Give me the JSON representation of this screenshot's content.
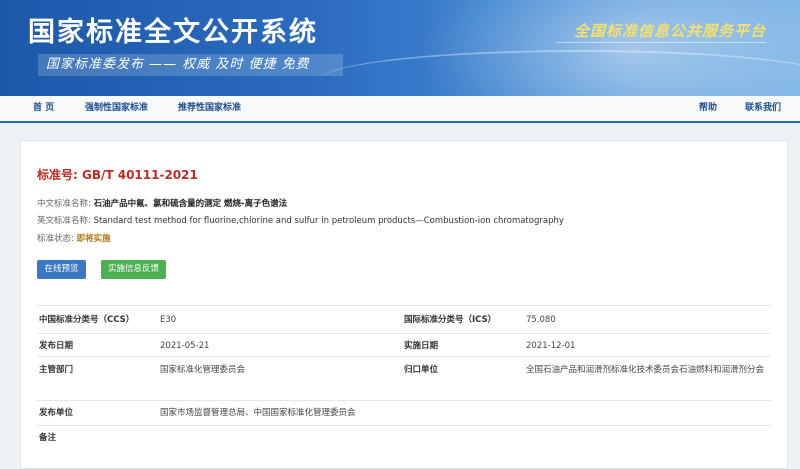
{
  "banner": {
    "title": "国家标准全文公开系统",
    "slogan": "国家标准委发布 —— 权威 及时 便捷 免费",
    "right_text": "全国标准信息公共服务平台"
  },
  "nav": {
    "home": "首 页",
    "mandatory": "强制性国家标准",
    "recommended": "推荐性国家标准",
    "help": "帮助",
    "contact": "联系我们"
  },
  "standard": {
    "number": "标准号: GB/T 40111-2021",
    "cn_label": "中文标准名称:",
    "cn_name": "石油产品中氟、氯和硫含量的测定 燃烧-离子色谱法",
    "en_label": "英文标准名称:",
    "en_name": "Standard test method for fluorine,chlorine and sulfur in petroleum products—Combustion-ion chromatography",
    "status_label": "标准状态:",
    "status": "即将实施"
  },
  "buttons": {
    "preview": "在线预览",
    "feedback": "实施信息反馈"
  },
  "details": {
    "ccs_label": "中国标准分类号（CCS）",
    "ccs": "E30",
    "ics_label": "国际标准分类号（ICS）",
    "ics": "75.080",
    "publish_label": "发布日期",
    "publish": "2021-05-21",
    "implement_label": "实施日期",
    "implement": "2021-12-01",
    "dept_label": "主管部门",
    "dept": "国家标准化管理委员会",
    "owner_label": "归口单位",
    "owner": "全国石油产品和润滑剂标准化技术委员会石油燃料和润滑剂分会",
    "issuer_label": "发布单位",
    "issuer": "国家市场监督管理总局、中国国家标准化管理委员会",
    "remark_label": "备注"
  },
  "colors": {
    "banner_blue": "#2b6cc0",
    "nav_border": "#2a67b3",
    "std_number_red": "#c22a20",
    "preview_button": "#3a79c2",
    "feedback_button": "#4caf50",
    "status_text": "#b07a10"
  }
}
